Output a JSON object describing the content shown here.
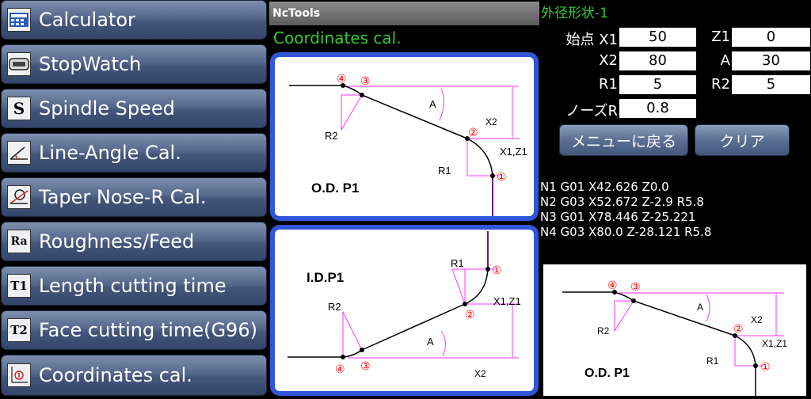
{
  "menu": {
    "items": [
      {
        "label": "Calculator",
        "icon": "calculator-icon",
        "glyph": ""
      },
      {
        "label": "StopWatch",
        "icon": "stopwatch-icon",
        "glyph": ""
      },
      {
        "label": "Spindle Speed",
        "icon": "spindle-speed-icon",
        "glyph": "S"
      },
      {
        "label": "Line-Angle Cal.",
        "icon": "line-angle-icon",
        "glyph": ""
      },
      {
        "label": "Taper Nose-R Cal.",
        "icon": "taper-nose-icon",
        "glyph": ""
      },
      {
        "label": "Roughness/Feed",
        "icon": "roughness-icon",
        "glyph": "Ra"
      },
      {
        "label": "Length cutting time",
        "icon": "length-time-icon",
        "glyph": "T1"
      },
      {
        "label": "Face cutting time(G96)",
        "icon": "face-time-icon",
        "glyph": "T2"
      },
      {
        "label": "Coordinates cal.",
        "icon": "coordinates-icon",
        "glyph": ""
      }
    ]
  },
  "window": {
    "title": "NcTools"
  },
  "screen": {
    "title": "Coordinates cal."
  },
  "diagrams": {
    "od": {
      "title": "O.D. P1",
      "labels": {
        "p4": "④",
        "p3": "③",
        "p2": "②",
        "p1": "①",
        "a": "A",
        "x2": "X2",
        "x1z1": "X1,Z1",
        "r1": "R1",
        "r2": "R2"
      }
    },
    "id": {
      "title": "I.D.P1",
      "labels": {
        "p4": "④",
        "p3": "③",
        "p2": "②",
        "p1": "①",
        "a": "A",
        "x2": "X2",
        "x1z1": "X1,Z1",
        "r1": "R1",
        "r2": "R2"
      }
    }
  },
  "form": {
    "title": "外径形状-1",
    "start_label": "始点 X1",
    "x1": "50",
    "z1_label": "Z1",
    "z1": "0",
    "x2_label": "X2",
    "x2": "80",
    "a_label": "A",
    "a": "30",
    "r1_label": "R1",
    "r1": "5",
    "r2_label": "R2",
    "r2": "5",
    "nose_label": "ノーズR",
    "nose": "0.8"
  },
  "buttons": {
    "back_label": "メニューに戻る",
    "clear_label": "クリア"
  },
  "gcode": [
    "N1 G01 X42.626 Z0.0",
    "N2 G03 X52.672 Z-2.9 R5.8",
    "N3 G01 X78.446 Z-25.221",
    "N4 G03 X80.0 Z-28.121 R5.8"
  ],
  "colors": {
    "accent_green": "#33cc33",
    "card_border": "#2f56d6",
    "dimension_magenta": "#ff33ff",
    "point_red": "#ff0000"
  }
}
